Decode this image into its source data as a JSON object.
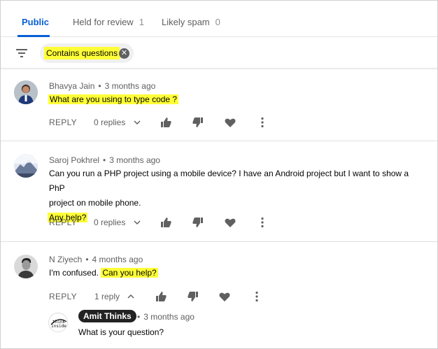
{
  "tabs": [
    {
      "label": "Public",
      "count": ""
    },
    {
      "label": "Held for review",
      "count": "1"
    },
    {
      "label": "Likely spam",
      "count": "0"
    }
  ],
  "filter": {
    "chip_label": "Contains questions",
    "chip_remove_icon": "close-circle-icon",
    "filter_icon": "filter-icon"
  },
  "comments": [
    {
      "author": "Bhavya Jain",
      "time": "3 months ago",
      "text": "What are you using to type code ?",
      "reply_label": "REPLY",
      "replies_label": "0 replies"
    },
    {
      "author": "Saroj Pokhrel",
      "time": "3 months ago",
      "text_line1": "Can you run a PHP project using a mobile device? I have an Android project but I want to show a PhP",
      "text_line2": "project on mobile phone.",
      "text_highlight": "Any help?",
      "reply_label": "REPLY",
      "replies_label": "0 replies"
    },
    {
      "author": "N Ziyech",
      "time": "4 months ago",
      "text_plain": "I'm confused.",
      "text_highlight": "Can you help?",
      "reply_label": "REPLY",
      "replies_label": "1 reply"
    }
  ],
  "reply": {
    "author": "Amit Thinks",
    "time": "3 months ago",
    "text": "What is your question?",
    "avatar_text_1": "think",
    "avatar_text_2": "inside"
  },
  "colors": {
    "accent": "#065fd4",
    "highlight": "#ffff38",
    "icon": "#606060"
  }
}
